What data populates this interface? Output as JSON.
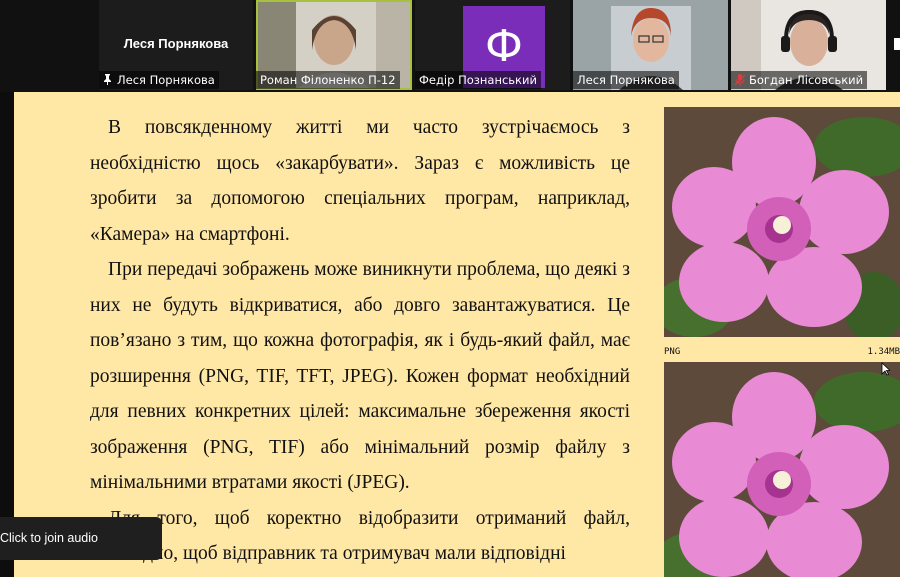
{
  "participants": [
    {
      "big_name": "Леся Порнякова",
      "label": "Леся Порнякова",
      "pinned": true
    },
    {
      "label": "Роман Філоненко П-12",
      "active": true
    },
    {
      "label": "Федір Познанський",
      "avatar_letter": "Ф",
      "avatar_color": "#7a2db8"
    },
    {
      "label": "Леся Порнякова"
    },
    {
      "label": "Богдан Лісовський",
      "muted": true
    }
  ],
  "slide": {
    "paragraphs": [
      "В повсякденному житті ми часто зустрічаємось з необхідністю щось «закарбувати». Зараз є можливість це зробити за допомогою спеціальних програм, наприклад, «Камера» на смартфоні.",
      "При передачі зображень може виникнути проблема, що деякі з них не будуть відкриватися, або довго завантажуватися. Це пов’язано з тим, що кожна фотографія, як і будь-який файл, має розширення (PNG, TIF, TFT, JPEG). Кожен формат необхідний для певних конкретних цілей: максимальне збереження якості зображення (PNG, TIF) або мінімальний розмір файлу з мінімальними втратами якості (JPEG).",
      "Для того, щоб коректно відобразити отриманий файл, необхідно, щоб відправник та отримувач мали відповідні"
    ],
    "image1": {
      "format": "PNG",
      "size": "1.34MB"
    }
  },
  "toast": {
    "text": "Click to join audio"
  },
  "colors": {
    "slide_bg": "#ffe7a6",
    "active_border": "#a7c13f",
    "flower": "#e88ad4"
  }
}
